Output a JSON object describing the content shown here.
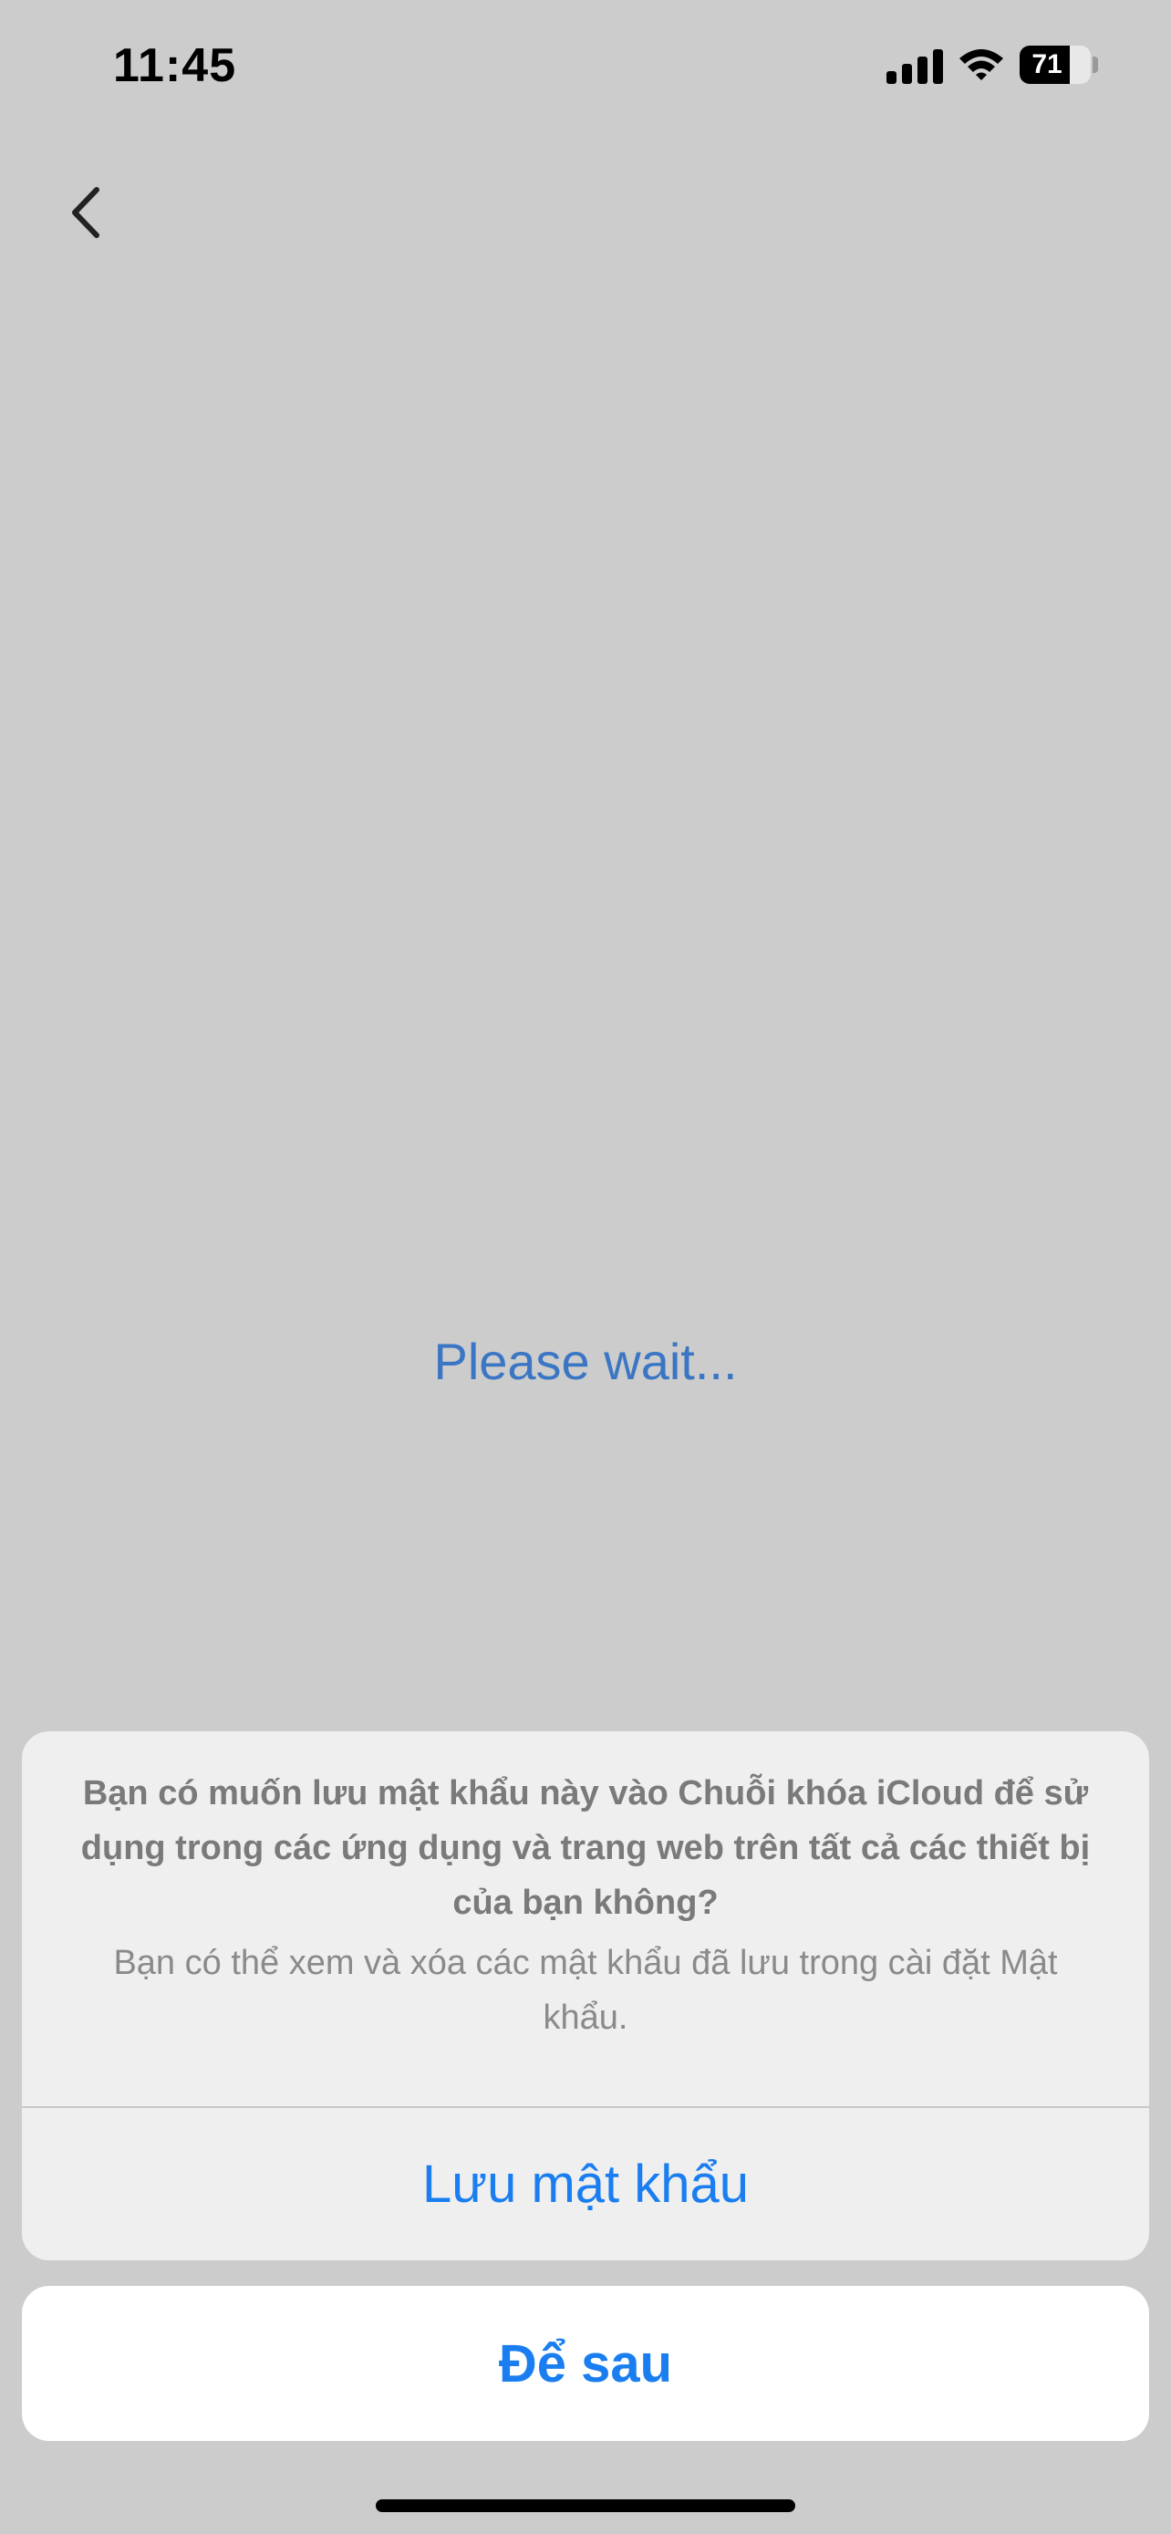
{
  "status_bar": {
    "time": "11:45",
    "battery_percent": "71",
    "battery_level": 0.71,
    "signal_icon": "cellular-signal-icon",
    "wifi_icon": "wifi-icon",
    "battery_icon": "battery-icon"
  },
  "nav": {
    "back_icon": "chevron-left-icon"
  },
  "main": {
    "loading_text": "Please wait..."
  },
  "dialog": {
    "title": "Bạn có muốn lưu mật khẩu này vào Chuỗi khóa iCloud để sử dụng trong các ứng dụng và trang web trên tất cả các thiết bị của bạn không?",
    "message": "Bạn có thể xem và xóa các mật khẩu đã lưu trong cài đặt Mật khẩu.",
    "save_label": "Lưu mật khẩu",
    "later_label": "Để sau"
  },
  "colors": {
    "background": "#cccccc",
    "accent": "#1a7ef0",
    "loading_text": "#3a76c4"
  }
}
